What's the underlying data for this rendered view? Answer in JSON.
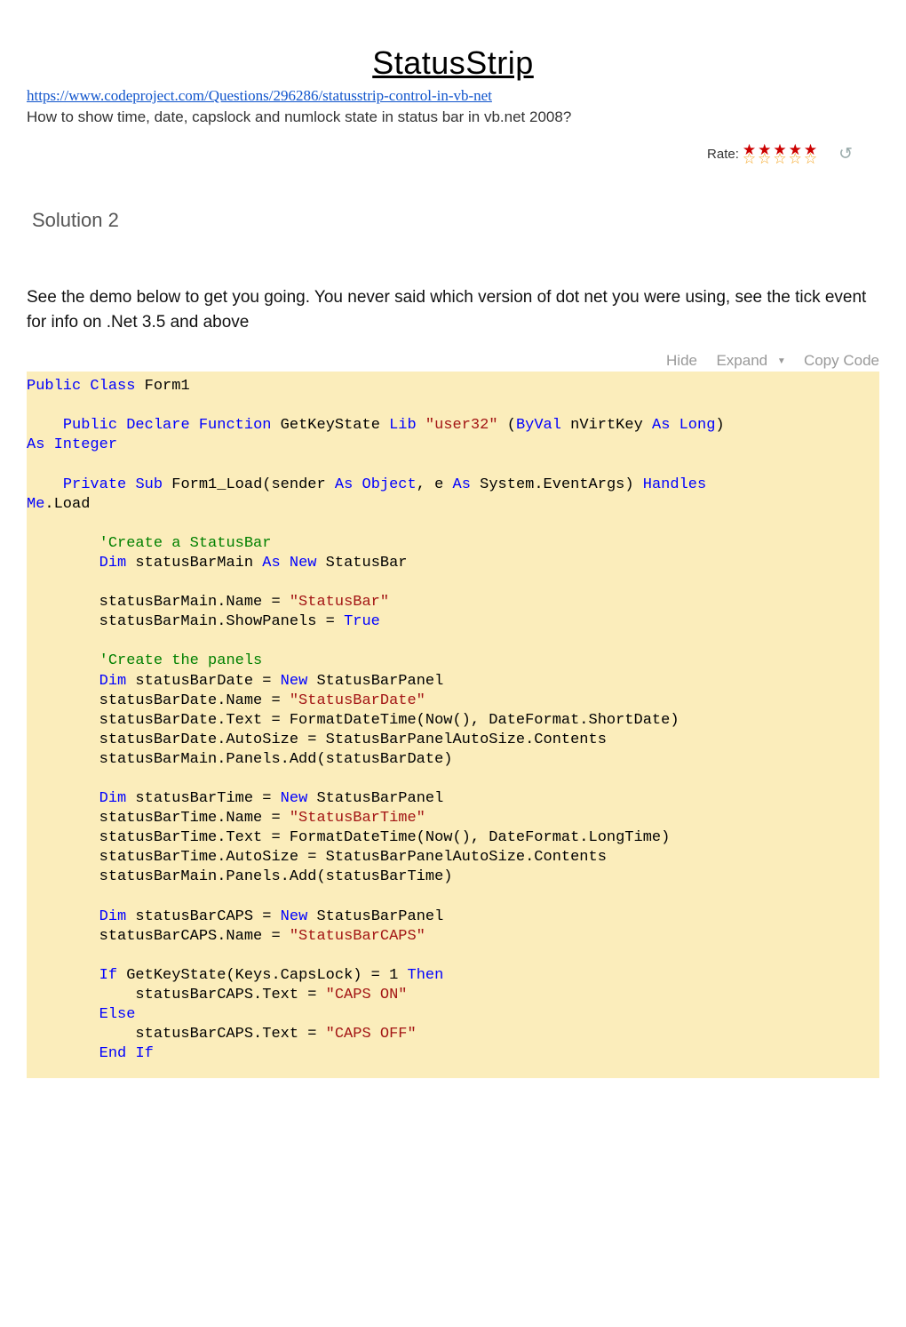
{
  "title": "StatusStrip",
  "source_url": "https://www.codeproject.com/Questions/296286/statusstrip-control-in-vb-net",
  "question": "How to show time, date, capslock and numlock state in status bar in vb.net 2008?",
  "rate_label": "Rate:",
  "stars_filled": "★★★★★",
  "stars_empty": "☆☆☆☆☆",
  "solution_heading": "Solution 2",
  "intro": "See the demo below to get you going. You never said which version of dot net you were using, see the tick event for info on .Net 3.5 and above",
  "actions": {
    "hide": "Hide",
    "expand": "Expand",
    "copy": "Copy Code"
  },
  "code": {
    "l01a": "Public",
    "l01b": "Class",
    "l01c": " Form1",
    "l02a": "Public",
    "l02b": "Declare",
    "l02c": "Function",
    "l02d": " GetKeyState ",
    "l02e": "Lib",
    "l02f": "\"user32\"",
    "l02g": "ByVal",
    "l02h": " nVirtKey ",
    "l02i": "As",
    "l02j": "Long",
    "l02k": "As",
    "l02l": "Integer",
    "l03a": "Private",
    "l03b": "Sub",
    "l03c": " Form1_Load(sender ",
    "l03d": "As",
    "l03e": "Object",
    "l03f": ", e ",
    "l03g": "As",
    "l03h": " System.EventArgs) ",
    "l03i": "Handles",
    "l03j": "Me",
    "l03k": ".Load",
    "c1": "'Create a StatusBar",
    "l04a": "Dim",
    "l04b": " statusBarMain ",
    "l04c": "As",
    "l04d": "New",
    "l04e": " StatusBar",
    "l05a": "        statusBarMain.Name = ",
    "l05b": "\"StatusBar\"",
    "l06a": "        statusBarMain.ShowPanels = ",
    "l06b": "True",
    "c2": "'Create the panels",
    "l07a": "Dim",
    "l07b": " statusBarDate = ",
    "l07c": "New",
    "l07d": " StatusBarPanel",
    "l08a": "        statusBarDate.Name = ",
    "l08b": "\"StatusBarDate\"",
    "l09": "        statusBarDate.Text = FormatDateTime(Now(), DateFormat.ShortDate)",
    "l10": "        statusBarDate.AutoSize = StatusBarPanelAutoSize.Contents",
    "l11": "        statusBarMain.Panels.Add(statusBarDate)",
    "l12a": "Dim",
    "l12b": " statusBarTime = ",
    "l12c": "New",
    "l12d": " StatusBarPanel",
    "l13a": "        statusBarTime.Name = ",
    "l13b": "\"StatusBarTime\"",
    "l14": "        statusBarTime.Text = FormatDateTime(Now(), DateFormat.LongTime)",
    "l15": "        statusBarTime.AutoSize = StatusBarPanelAutoSize.Contents",
    "l16": "        statusBarMain.Panels.Add(statusBarTime)",
    "l17a": "Dim",
    "l17b": " statusBarCAPS = ",
    "l17c": "New",
    "l17d": " StatusBarPanel",
    "l18a": "        statusBarCAPS.Name = ",
    "l18b": "\"StatusBarCAPS\"",
    "l19a": "If",
    "l19b": " GetKeyState(Keys.CapsLock) = ",
    "l19c": "1",
    "l19d": "Then",
    "l20a": "            statusBarCAPS.Text = ",
    "l20b": "\"CAPS ON\"",
    "l21a": "Else",
    "l22a": "            statusBarCAPS.Text = ",
    "l22b": "\"CAPS OFF\"",
    "l23a": "End",
    "l23b": "If"
  }
}
